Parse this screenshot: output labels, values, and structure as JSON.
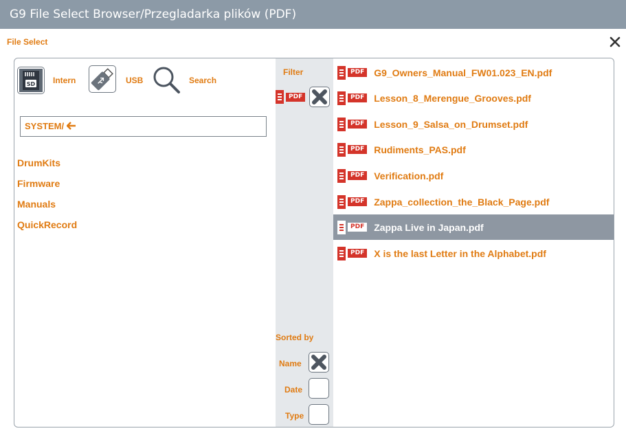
{
  "window": {
    "title": "G9 File Select Browser/Przegladarka plików (PDF)"
  },
  "dialog": {
    "section_label": "File Select",
    "close_glyph": "✕"
  },
  "sources": [
    {
      "label": "Intern",
      "icon": "sd-card-icon"
    },
    {
      "label": "USB",
      "icon": "usb-stick-icon"
    },
    {
      "label": "Search",
      "icon": "search-icon"
    }
  ],
  "path": {
    "value": "SYSTEM/",
    "back_glyph": "🡰"
  },
  "folders": [
    "DrumKits",
    "Firmware",
    "Manuals",
    "QuickRecord"
  ],
  "filter": {
    "label": "Filter",
    "type_tag": "PDF",
    "active": true
  },
  "sort": {
    "label": "Sorted by",
    "options": [
      {
        "label": "Name",
        "checked": true
      },
      {
        "label": "Date",
        "checked": false
      },
      {
        "label": "Type",
        "checked": false
      }
    ]
  },
  "files": [
    {
      "name": "G9_Owners_Manual_FW01.023_EN.pdf",
      "selected": false
    },
    {
      "name": "Lesson_8_Merengue_Grooves.pdf",
      "selected": false
    },
    {
      "name": "Lesson_9_Salsa_on_Drumset.pdf",
      "selected": false
    },
    {
      "name": "Rudiments_PAS.pdf",
      "selected": false
    },
    {
      "name": "Verification.pdf",
      "selected": false
    },
    {
      "name": "Zappa_collection_the_Black_Page.pdf",
      "selected": false
    },
    {
      "name": "Zappa Live in Japan.pdf",
      "selected": true
    },
    {
      "name": "X is the last Letter in the Alphabet.pdf",
      "selected": false
    }
  ],
  "pdf_tag": "PDF",
  "colors": {
    "title_bar": "#8c9aa7",
    "accent_orange": "#e07b12",
    "pdf_red": "#d4342a",
    "selection": "#8e97a2",
    "strip": "#e5e8eb"
  }
}
